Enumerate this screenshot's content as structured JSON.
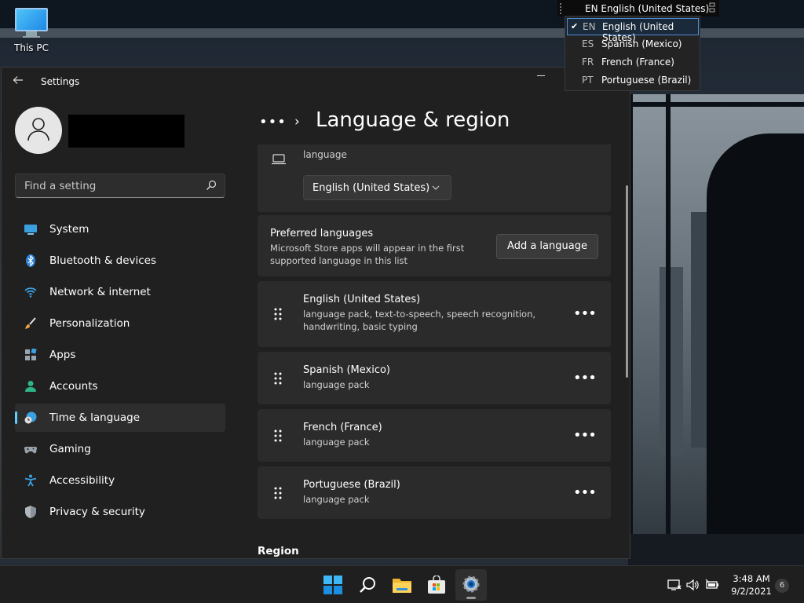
{
  "desktop": {
    "this_pc_label": "This PC"
  },
  "window": {
    "title": "Settings",
    "breadcrumb_more": "•••",
    "breadcrumb_separator": "›",
    "page_title": "Language & region",
    "search_placeholder": "Find a setting"
  },
  "sidebar": {
    "items": [
      {
        "label": "System",
        "icon": "system-icon",
        "selected": false
      },
      {
        "label": "Bluetooth & devices",
        "icon": "bluetooth-icon",
        "selected": false
      },
      {
        "label": "Network & internet",
        "icon": "wifi-icon",
        "selected": false
      },
      {
        "label": "Personalization",
        "icon": "brush-icon",
        "selected": false
      },
      {
        "label": "Apps",
        "icon": "apps-icon",
        "selected": false
      },
      {
        "label": "Accounts",
        "icon": "person-icon",
        "selected": false
      },
      {
        "label": "Time & language",
        "icon": "clock-globe-icon",
        "selected": true
      },
      {
        "label": "Gaming",
        "icon": "gamepad-icon",
        "selected": false
      },
      {
        "label": "Accessibility",
        "icon": "accessibility-icon",
        "selected": false
      },
      {
        "label": "Privacy & security",
        "icon": "shield-icon",
        "selected": false
      }
    ]
  },
  "display_language": {
    "partial_text": "language",
    "dropdown_value": "English (United States)"
  },
  "preferred_languages": {
    "title": "Preferred languages",
    "subtitle": "Microsoft Store apps will appear in the first supported language in this list",
    "add_button": "Add a language"
  },
  "languages": [
    {
      "name": "English (United States)",
      "features": "language pack, text-to-speech, speech recognition, handwriting, basic typing"
    },
    {
      "name": "Spanish (Mexico)",
      "features": "language pack"
    },
    {
      "name": "French (France)",
      "features": "language pack"
    },
    {
      "name": "Portuguese (Brazil)",
      "features": "language pack"
    }
  ],
  "more_glyph": "•••",
  "region_heading": "Region",
  "ime": {
    "current": "EN English (United States)"
  },
  "language_flyout": {
    "options": [
      {
        "code": "EN",
        "name": "English (United States)",
        "selected": true
      },
      {
        "code": "ES",
        "name": "Spanish (Mexico)",
        "selected": false
      },
      {
        "code": "FR",
        "name": "French (France)",
        "selected": false
      },
      {
        "code": "PT",
        "name": "Portuguese (Brazil)",
        "selected": false
      }
    ]
  },
  "taskbar": {
    "time": "3:48 AM",
    "date": "9/2/2021",
    "notification_count": "6"
  },
  "colors": {
    "accent": "#60cdff",
    "window_bg": "#202020",
    "card_bg": "#2b2b2b",
    "taskbar_bg": "#1f1f1f"
  }
}
